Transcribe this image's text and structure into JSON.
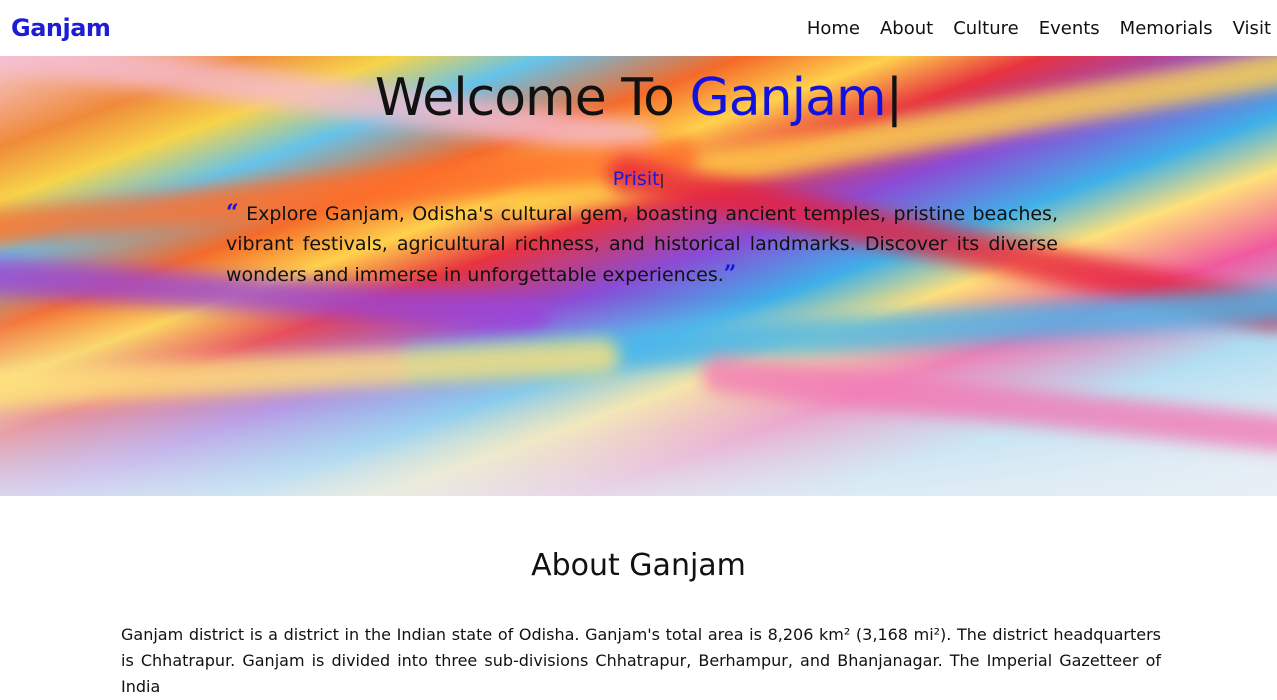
{
  "navbar": {
    "brand": "Ganjam",
    "links": [
      "Home",
      "About",
      "Culture",
      "Events",
      "Memorials",
      "Visit"
    ]
  },
  "hero": {
    "title_prefix": "Welcome To ",
    "title_accent": "Ganjam",
    "title_cursor": "|",
    "author": "Prisit",
    "author_cursor": "|",
    "open_quote": "“",
    "close_quote": "”",
    "quote": "Explore Ganjam, Odisha's cultural gem, boasting ancient temples, pristine beaches, vibrant festivals, agricultural richness, and historical landmarks. Discover its diverse wonders and immerse in unforgettable experiences."
  },
  "about": {
    "title": "About Ganjam",
    "text": "Ganjam district is a district in the Indian state of Odisha. Ganjam's total area is 8,206 km² (3,168 mi²). The district headquarters is Chhatrapur. Ganjam is divided into three sub-divisions Chhatrapur, Berhampur, and Bhanjanagar. The Imperial Gazetteer of India"
  },
  "colors": {
    "accent": "#1111e0",
    "text": "#111111",
    "background": "#ffffff"
  }
}
